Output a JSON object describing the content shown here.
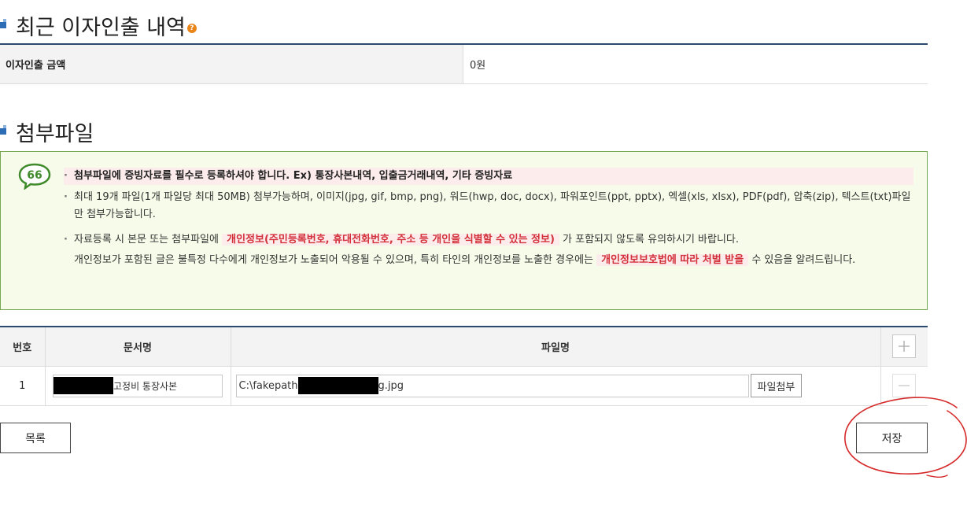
{
  "interest_section": {
    "title": "최근 이자인출 내역",
    "help_icon": "question-circle-icon",
    "row_label": "이자인출 금액",
    "row_value": "0원"
  },
  "attach_section": {
    "title": "첨부파일",
    "notice": {
      "icon": "speech-bubble-quote-icon",
      "line1": "첨부파일에 증빙자료를 필수로 등록하셔야 합니다. Ex) 통장사본내역, 입출금거래내역, 기타 증빙자료",
      "line2": "최대 19개 파일(1개 파일당 최대 50MB) 첨부가능하며, 이미지(jpg, gif, bmp, png), 워드(hwp, doc, docx), 파워포인트(ppt, pptx), 엑셀(xls, xlsx), PDF(pdf), 압축(zip), 텍스트(txt)파일만 첨부가능합니다.",
      "line3_pre": "자료등록 시 본문 또는 첨부파일에",
      "line3_hl": "개인정보(주민등록번호, 휴대전화번호, 주소 등 개인을 식별할 수 있는 정보)",
      "line3_post": "가 포함되지 않도록 유의하시기 바랍니다.",
      "line4_pre": "개인정보가 포함된 글은 불특정 다수에게 개인정보가 노출되어 악용될 수 있으며, 특히 타인의 개인정보를 노출한 경우에는",
      "line4_hl": "개인정보보호법에 따라 처벌 받을",
      "line4_post": "수 있음을 알려드립니다."
    }
  },
  "files_table": {
    "headers": {
      "no": "번호",
      "doc": "문서명",
      "file": "파일명"
    },
    "add_icon": "plus-icon",
    "rows": [
      {
        "no": "1",
        "doc_name_visible": "고정비 통장사본",
        "file_path_prefix": "C:\\fakepath",
        "file_path_suffix": "g.jpg",
        "attach_label": "파일첨부",
        "remove_icon": "minus-icon"
      }
    ]
  },
  "buttons": {
    "list_label": "목록",
    "save_label": "저장"
  },
  "annotation": {
    "color": "#d62a2a"
  },
  "colors": {
    "title_bar": "#2a4a6e",
    "notice_border": "#76a752",
    "notice_bg": "#f7fbe9",
    "highlight_text": "#d3313a",
    "help_icon": "#e8861c"
  }
}
